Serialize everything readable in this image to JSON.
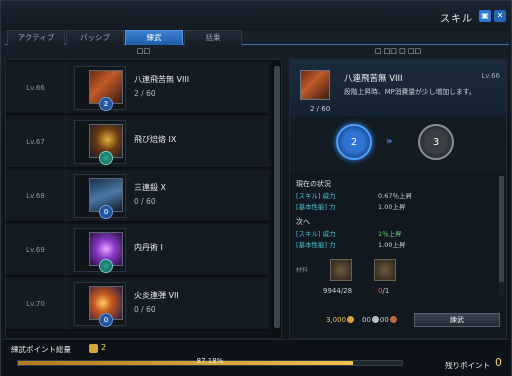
{
  "window": {
    "title": "スキル"
  },
  "tabs": [
    {
      "label": "アクティブ"
    },
    {
      "label": "パッシブ"
    },
    {
      "label": "練武"
    },
    {
      "label": "括乗"
    }
  ],
  "headers": {
    "left": "□□",
    "right": "□ □□ □ □□"
  },
  "skills": [
    {
      "level": "Lv.66",
      "name": "八連飛苦無 VIII",
      "count": "2 / 60",
      "badge": "2"
    },
    {
      "level": "Lv.67",
      "name": "飛び焙烙 IX",
      "count": "",
      "badge": ""
    },
    {
      "level": "Lv.68",
      "name": "三連殺 X",
      "count": "0 / 60",
      "badge": "0"
    },
    {
      "level": "Lv.69",
      "name": "内丹術 I",
      "count": "",
      "badge": ""
    },
    {
      "level": "Lv.70",
      "name": "火炎連弾 VII",
      "count": "0 / 60",
      "badge": "0"
    }
  ],
  "detail": {
    "name": "八連飛苦無 VIII",
    "level": "Lv.66",
    "description": "段階上昇時、MP消費量が少し増加します。",
    "count": "2 / 60",
    "current_level": "2",
    "next_level": "3",
    "arrows": "»",
    "current_title": "現在の状況",
    "current_effects": [
      {
        "tag": "[スキル] 威力",
        "value": "0.67％上昇"
      },
      {
        "tag": "[基本性能] 力",
        "value": "1.00上昇"
      }
    ],
    "next_title": "次へ",
    "next_effects": [
      {
        "tag": "[スキル] 威力",
        "value": "1％上昇"
      },
      {
        "tag": "[基本性能] 力",
        "value": "1.00上昇"
      }
    ],
    "materials_label": "材料",
    "materials": [
      {
        "owned": "9944",
        "required": "/28"
      },
      {
        "owned": "0",
        "required": "/1"
      }
    ],
    "cost_gold": "3,000",
    "cost_rest": "00",
    "cost_rest2": "00",
    "train_button": "練武"
  },
  "footer": {
    "points_label": "練武ポイント総量",
    "points_value": "2",
    "progress": 87.18,
    "progress_text": "87.18%",
    "remain_label": "残りポイント",
    "remain_value": "0"
  },
  "colors": {
    "accent": "#2f6fca",
    "gold": "#f0d070",
    "teal": "#4cc3d3",
    "up": "#5fd17a",
    "warn": "#e25050"
  }
}
